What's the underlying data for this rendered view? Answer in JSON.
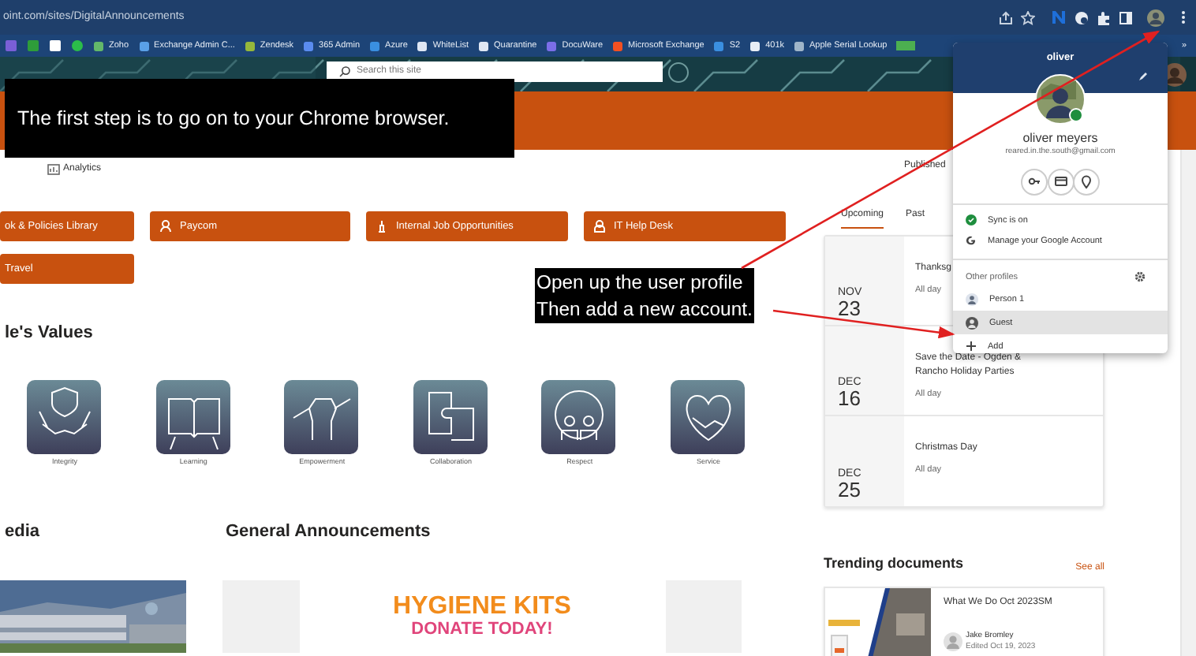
{
  "browser": {
    "url": "oint.com/sites/DigitalAnnouncements",
    "bookmarks": [
      {
        "label": "Zoho"
      },
      {
        "label": "Exchange Admin C..."
      },
      {
        "label": "Zendesk"
      },
      {
        "label": "365 Admin"
      },
      {
        "label": "Azure"
      },
      {
        "label": "WhiteList"
      },
      {
        "label": "Quarantine"
      },
      {
        "label": "DocuWare"
      },
      {
        "label": "Microsoft Exchange"
      },
      {
        "label": "S2"
      },
      {
        "label": "401k"
      },
      {
        "label": "Apple Serial Lookup"
      }
    ],
    "overflow": "»"
  },
  "site": {
    "search_placeholder": "Search this site",
    "nav": [
      {
        "label": "Analytics"
      }
    ],
    "published": "Published"
  },
  "quick_links": [
    {
      "label": "ok & Policies Library"
    },
    {
      "label": "Paycom"
    },
    {
      "label": "Internal Job Opportunities"
    },
    {
      "label": "IT Help Desk"
    },
    {
      "label": "Travel"
    }
  ],
  "values": {
    "heading": "le's Values",
    "items": [
      {
        "label": "Integrity"
      },
      {
        "label": "Learning"
      },
      {
        "label": "Empowerment"
      },
      {
        "label": "Collaboration"
      },
      {
        "label": "Respect"
      },
      {
        "label": "Service"
      }
    ]
  },
  "media": {
    "heading": "edia"
  },
  "announcements": {
    "heading": "General Announcements",
    "title": "HYGIENE KITS",
    "subtitle": "DONATE TODAY!"
  },
  "events": {
    "tabs": [
      {
        "label": "Upcoming",
        "selected": true
      },
      {
        "label": "Past",
        "selected": false
      }
    ],
    "items": [
      {
        "month": "NOV",
        "day": "23",
        "title": "Thanksg",
        "time": "All day"
      },
      {
        "month": "DEC",
        "day": "16",
        "title": "Save the Date - Ogden & Rancho Holiday Parties",
        "time": "All day"
      },
      {
        "month": "DEC",
        "day": "25",
        "title": "Christmas Day",
        "time": "All day"
      }
    ]
  },
  "trending": {
    "heading": "Trending documents",
    "see_all": "See all",
    "docs": [
      {
        "title": "What We Do Oct 2023SM",
        "author": "Jake Bromley",
        "edited": "Edited Oct 19, 2023"
      }
    ]
  },
  "profile_menu": {
    "header": "oliver",
    "name": "oliver meyers",
    "email": "reared.in.the.south@gmail.com",
    "sync": "Sync is on",
    "manage": "Manage your Google Account",
    "other_heading": "Other profiles",
    "profiles": [
      {
        "label": "Person 1",
        "selected": false
      },
      {
        "label": "Guest",
        "selected": true
      }
    ],
    "add": "Add"
  },
  "annotations": [
    {
      "lines": [
        "The first step is to go on to your Chrome browser."
      ]
    },
    {
      "lines": [
        "Open up the user profile",
        "Then add a new account."
      ]
    }
  ]
}
